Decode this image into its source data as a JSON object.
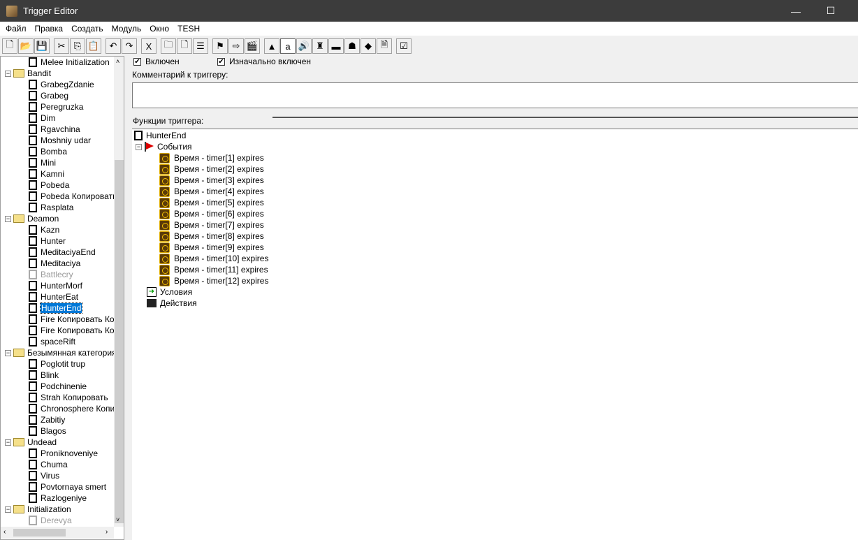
{
  "window": {
    "title": "Trigger Editor",
    "minimize": "—",
    "maximize": "☐"
  },
  "menu": [
    "Файл",
    "Правка",
    "Создать",
    "Модуль",
    "Окно",
    "TESH"
  ],
  "toolbar": [
    {
      "name": "new",
      "g": "🗋"
    },
    {
      "name": "open",
      "g": "📂"
    },
    {
      "name": "save",
      "g": "💾"
    },
    {
      "name": "cut",
      "g": "✂",
      "sep": true
    },
    {
      "name": "copy",
      "g": "⎘"
    },
    {
      "name": "paste",
      "g": "📋"
    },
    {
      "name": "undo",
      "g": "↶",
      "sep": true
    },
    {
      "name": "redo",
      "g": "↷"
    },
    {
      "name": "delete",
      "g": "X",
      "sep": true
    },
    {
      "name": "new-category",
      "g": "🗀",
      "sep": true
    },
    {
      "name": "new-trigger",
      "g": "🗋"
    },
    {
      "name": "new-comment",
      "g": "☰"
    },
    {
      "name": "new-event",
      "g": "⚑",
      "sep": true
    },
    {
      "name": "new-condition",
      "g": "⇨"
    },
    {
      "name": "new-action",
      "g": "🎬"
    },
    {
      "name": "terrain",
      "g": "▲",
      "sep": true
    },
    {
      "name": "text",
      "g": "a",
      "active": true
    },
    {
      "name": "sound",
      "g": "🔊"
    },
    {
      "name": "unit",
      "g": "♜"
    },
    {
      "name": "object",
      "g": "▬"
    },
    {
      "name": "ai",
      "g": "☗"
    },
    {
      "name": "import",
      "g": "◆"
    },
    {
      "name": "script",
      "g": "🗎"
    },
    {
      "name": "test-map",
      "g": "☑",
      "sep": true
    }
  ],
  "tree": [
    {
      "l": 2,
      "t": "doc",
      "label": "Melee Initialization"
    },
    {
      "l": 0,
      "t": "folder",
      "label": "Bandit"
    },
    {
      "l": 1,
      "t": "doc",
      "label": "GrabegZdanie"
    },
    {
      "l": 1,
      "t": "doc",
      "label": "Grabeg"
    },
    {
      "l": 1,
      "t": "doc",
      "label": "Peregruzka"
    },
    {
      "l": 1,
      "t": "doc",
      "label": "Dim"
    },
    {
      "l": 1,
      "t": "doc",
      "label": "Rgavchina"
    },
    {
      "l": 1,
      "t": "doc",
      "label": "Moshniy udar"
    },
    {
      "l": 1,
      "t": "doc",
      "label": "Bomba"
    },
    {
      "l": 1,
      "t": "doc",
      "label": "Mini"
    },
    {
      "l": 1,
      "t": "doc",
      "label": "Kamni"
    },
    {
      "l": 1,
      "t": "doc",
      "label": "Pobeda"
    },
    {
      "l": 1,
      "t": "doc",
      "label": "Pobeda Копировать"
    },
    {
      "l": 1,
      "t": "doc",
      "label": "Rasplata"
    },
    {
      "l": 0,
      "t": "folder",
      "label": "Deamon"
    },
    {
      "l": 1,
      "t": "doc",
      "label": "Kazn"
    },
    {
      "l": 1,
      "t": "doc",
      "label": "Hunter"
    },
    {
      "l": 1,
      "t": "doc",
      "label": "MeditaciyaEnd"
    },
    {
      "l": 1,
      "t": "doc",
      "label": "Meditaciya"
    },
    {
      "l": 1,
      "t": "doc",
      "label": "Battlecry",
      "disabled": true
    },
    {
      "l": 1,
      "t": "doc",
      "label": "HunterMorf"
    },
    {
      "l": 1,
      "t": "doc",
      "label": "HunterEat"
    },
    {
      "l": 1,
      "t": "doc",
      "label": "HunterEnd",
      "selected": true
    },
    {
      "l": 1,
      "t": "doc",
      "label": "Fire Копировать Копировать"
    },
    {
      "l": 1,
      "t": "doc",
      "label": "Fire Копировать Копировать"
    },
    {
      "l": 1,
      "t": "doc",
      "label": "spaceRift"
    },
    {
      "l": 0,
      "t": "folder",
      "label": "Безымянная категория"
    },
    {
      "l": 1,
      "t": "doc",
      "label": "Poglotit trup"
    },
    {
      "l": 1,
      "t": "doc",
      "label": "Blink"
    },
    {
      "l": 1,
      "t": "doc",
      "label": "Podchinenie"
    },
    {
      "l": 1,
      "t": "doc",
      "label": "Strah Копировать"
    },
    {
      "l": 1,
      "t": "doc",
      "label": "Chronosphere Копировать"
    },
    {
      "l": 1,
      "t": "doc",
      "label": "Zabitiy"
    },
    {
      "l": 1,
      "t": "doc",
      "label": "Blagos"
    },
    {
      "l": 0,
      "t": "folder",
      "label": "Undead"
    },
    {
      "l": 1,
      "t": "doc",
      "label": "Proniknoveniye"
    },
    {
      "l": 1,
      "t": "doc",
      "label": "Chuma"
    },
    {
      "l": 1,
      "t": "doc",
      "label": "Virus"
    },
    {
      "l": 1,
      "t": "doc",
      "label": "Povtornaya smert"
    },
    {
      "l": 1,
      "t": "doc",
      "label": "Razlogeniye"
    },
    {
      "l": 0,
      "t": "folder",
      "label": "Initialization"
    },
    {
      "l": 1,
      "t": "doc",
      "label": "Derevya",
      "disabled": true
    }
  ],
  "main": {
    "enabled_label": "Включен",
    "enabled": true,
    "initially_label": "Изначально включен",
    "initially": true,
    "comment_label": "Комментарий к триггеру:",
    "comment_value": "",
    "functions_label": "Функции триггера:",
    "trigger_name": "HunterEnd",
    "events_label": "События",
    "events": [
      "Время - timer[1] expires",
      "Время - timer[2] expires",
      "Время - timer[3] expires",
      "Время - timer[4] expires",
      "Время - timer[5] expires",
      "Время - timer[6] expires",
      "Время - timer[7] expires",
      "Время - timer[8] expires",
      "Время - timer[9] expires",
      "Время - timer[10] expires",
      "Время - timer[11] expires",
      "Время - timer[12] expires"
    ],
    "conditions_label": "Условия",
    "actions_label": "Действия"
  }
}
